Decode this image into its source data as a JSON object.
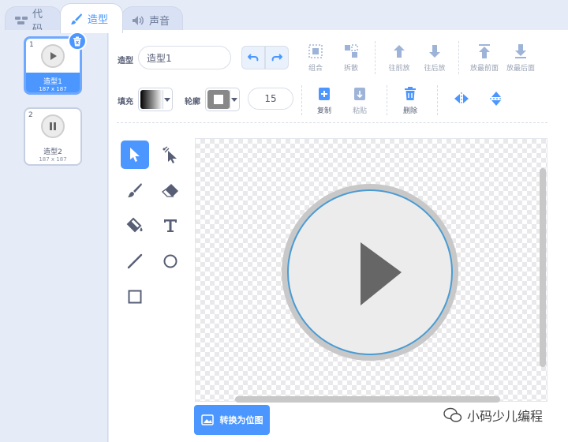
{
  "tabs": [
    {
      "label": "代码",
      "icon": "code-blocks-icon"
    },
    {
      "label": "造型",
      "icon": "brush-icon"
    },
    {
      "label": "声音",
      "icon": "speaker-icon"
    }
  ],
  "costumes": [
    {
      "number": "1",
      "name": "造型1",
      "size": "187 x 187",
      "thumb_icon": "play-icon",
      "selected": true
    },
    {
      "number": "2",
      "name": "造型2",
      "size": "187 x 187",
      "thumb_icon": "pause-icon",
      "selected": false
    }
  ],
  "toolbar": {
    "costume_label": "造型",
    "costume_name": "造型1",
    "group_label": "组合",
    "ungroup_label": "拆散",
    "forward_label": "往前放",
    "backward_label": "往后放",
    "front_label": "放最前面",
    "back_label": "放最后面",
    "fill_label": "填充",
    "outline_label": "轮廓",
    "outline_width": "15",
    "copy_label": "复制",
    "paste_label": "粘贴",
    "delete_label": "删除"
  },
  "canvas": {
    "convert_label": "转换为位图",
    "figure_icon": "play-icon"
  },
  "watermark": {
    "text": "小码少儿编程"
  },
  "colors": {
    "accent": "#4c97ff",
    "play_outer": "#c8c8c8",
    "play_inner": "#ececec",
    "play_ring": "#4a9bd2",
    "play_triangle": "#666666"
  }
}
